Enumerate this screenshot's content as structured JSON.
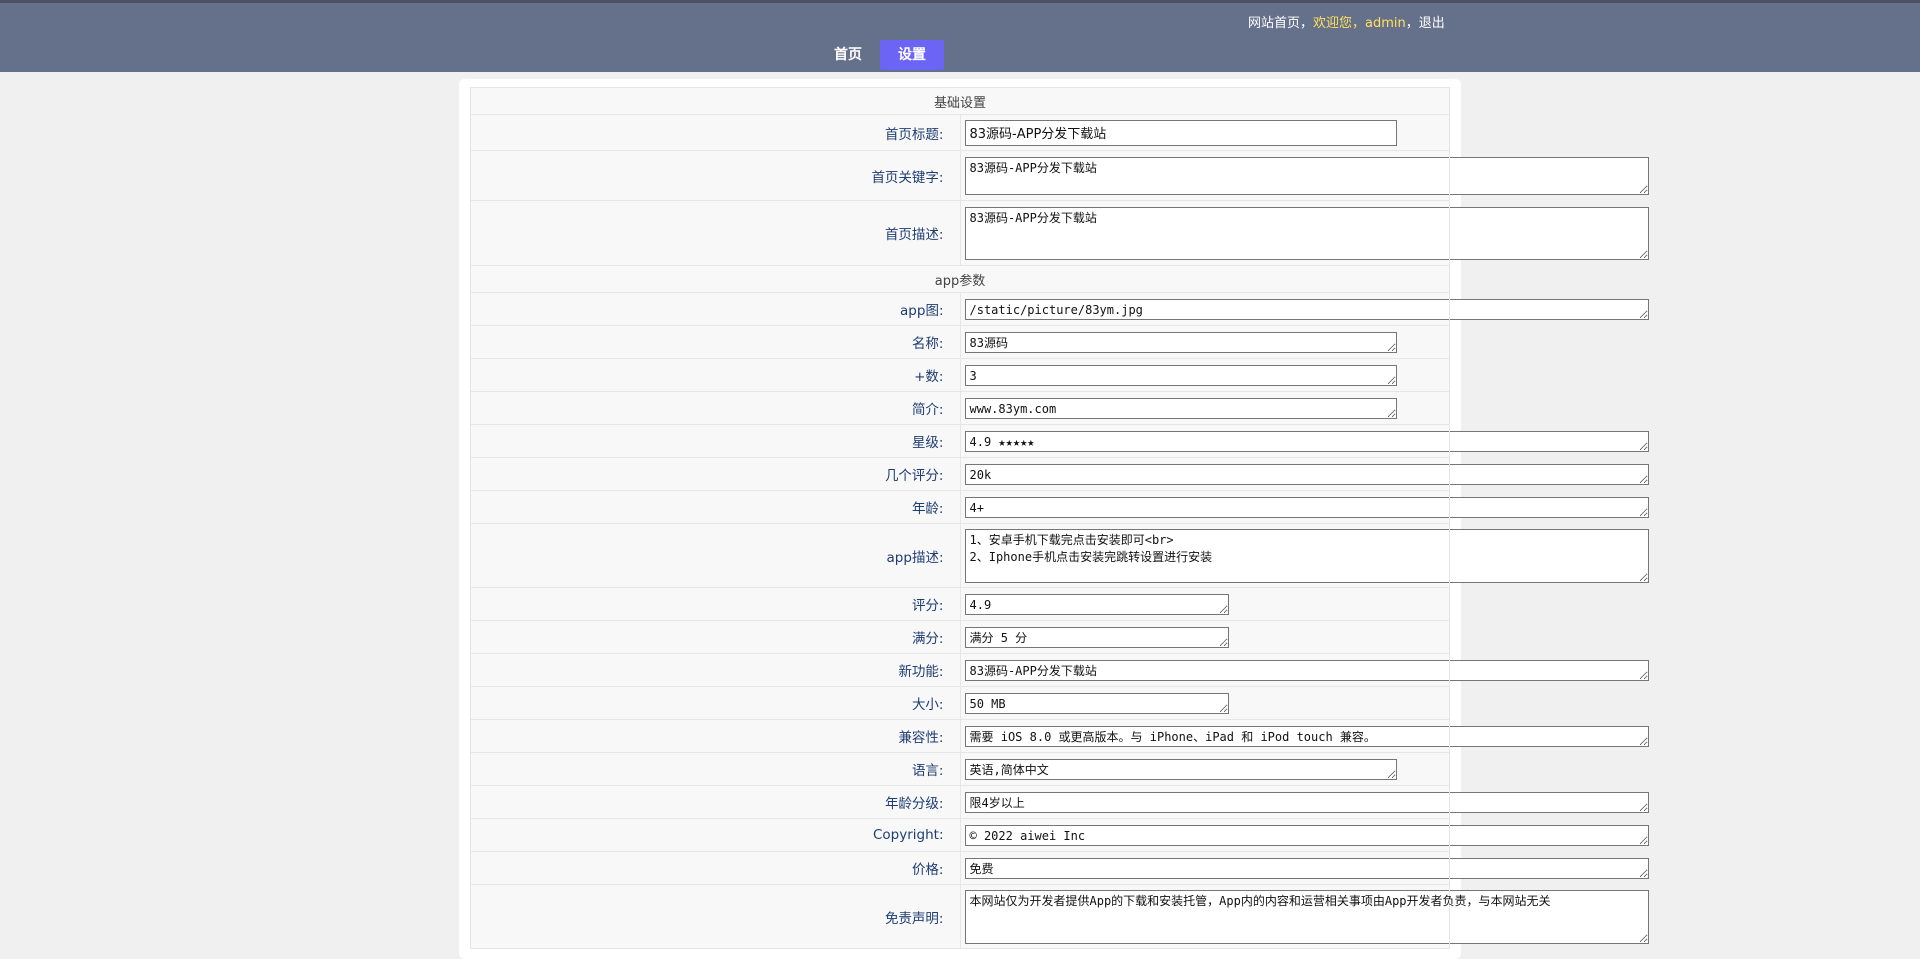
{
  "header": {
    "home_link": "网站首页",
    "sep1": "，",
    "welcome": "欢迎您，",
    "username": "admin",
    "sep2": "，",
    "logout": "退出"
  },
  "nav": {
    "home": "首页",
    "settings": "设置"
  },
  "basic": {
    "section_title": "基础设置",
    "fields": [
      {
        "label": "首页标题:",
        "value": "83源码-APP分发下载站"
      },
      {
        "label": "首页关键字:",
        "value": "83源码-APP分发下载站"
      },
      {
        "label": "首页描述:",
        "value": "83源码-APP分发下载站"
      }
    ]
  },
  "app": {
    "section_title": "app参数",
    "fields": [
      {
        "label": "app图:",
        "value": "/static/picture/83ym.jpg"
      },
      {
        "label": "名称:",
        "value": "83源码"
      },
      {
        "label": "+数:",
        "value": "3"
      },
      {
        "label": "简介:",
        "value": "www.83ym.com"
      },
      {
        "label": "星级:",
        "value": "4.9 ★★★★★"
      },
      {
        "label": "几个评分:",
        "value": "20k"
      },
      {
        "label": "年龄:",
        "value": "4+"
      },
      {
        "label": "app描述:",
        "value": "1、安卓手机下载完点击安装即可<br>\n2、Iphone手机点击安装完跳转设置进行安装"
      },
      {
        "label": "评分:",
        "value": "4.9"
      },
      {
        "label": "满分:",
        "value": "满分 5 分"
      },
      {
        "label": "新功能:",
        "value": "83源码-APP分发下载站"
      },
      {
        "label": "大小:",
        "value": "50 MB"
      },
      {
        "label": "兼容性:",
        "value": "需要 iOS 8.0 或更高版本。与 iPhone、iPad 和 iPod touch 兼容。"
      },
      {
        "label": "语言:",
        "value": "英语,简体中文"
      },
      {
        "label": "年龄分级:",
        "value": "限4岁以上"
      },
      {
        "label": "Copyright:",
        "value": "© 2022 aiwei Inc"
      },
      {
        "label": "价格:",
        "value": "免费"
      },
      {
        "label": "免责声明:",
        "value": "本网站仅为开发者提供App的下载和安装托管，App内的内容和运营相关事项由App开发者负责，与本网站无关"
      }
    ]
  }
}
